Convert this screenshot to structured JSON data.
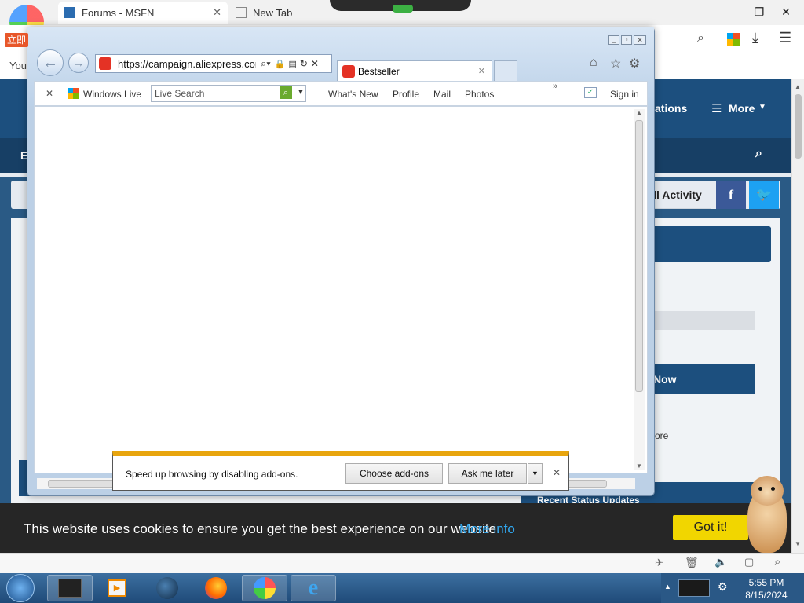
{
  "outer_browser": {
    "tabs": [
      {
        "label": "Forums - MSFN",
        "active": true
      },
      {
        "label": "New Tab",
        "active": false
      }
    ],
    "badge_text": "立即",
    "bookmark_text": "You",
    "window_controls": [
      "minimize-icon",
      "restore-icon",
      "close-icon"
    ]
  },
  "site": {
    "nav_fragment": "ations",
    "more_label": "More",
    "nav2_left": "E",
    "all_activity": "ll Activity",
    "now_button": "Now",
    "more_link": "ore",
    "recent_status": "Recent Status Updates",
    "cookie_text": "This website uses cookies to ensure you get the best experience on our website.",
    "cookie_link": "More info",
    "cookie_button": "Got it!"
  },
  "ie": {
    "url": "https://campaign.aliexpress.com",
    "tab_title": "Bestseller",
    "cmdbar": {
      "windows_live": "Windows Live",
      "search_placeholder": "Live Search",
      "links": [
        "What's New",
        "Profile",
        "Mail",
        "Photos"
      ],
      "sign_in": "Sign in"
    },
    "notification": {
      "message": "Speed up browsing by disabling add-ons.",
      "choose_button": "Choose add-ons",
      "later_button": "Ask me later"
    }
  },
  "taskbar": {
    "time": "5:55 PM",
    "date": "8/15/2024"
  },
  "colors": {
    "site_header": "#1c4f7e",
    "notification_stripe": "#e8a50e",
    "cookie_button": "#f1d600",
    "cookie_link": "#31a8f0",
    "facebook": "#3b5998",
    "twitter": "#1da1f2"
  }
}
